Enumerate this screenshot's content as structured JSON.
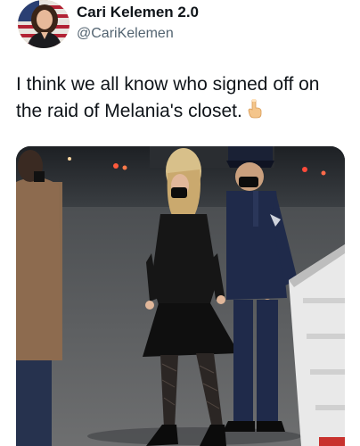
{
  "tweet": {
    "author": {
      "display_name": "Cari Kelemen 2.0",
      "handle": "@CariKelemen"
    },
    "text": "I think we all know who signed off on the raid of Melania's closet."
  },
  "icons": {
    "reaction_emoji": "hand-pointing-down-icon"
  },
  "colors": {
    "name_text": "#0f1419",
    "handle_text": "#536471",
    "background": "#ffffff"
  }
}
